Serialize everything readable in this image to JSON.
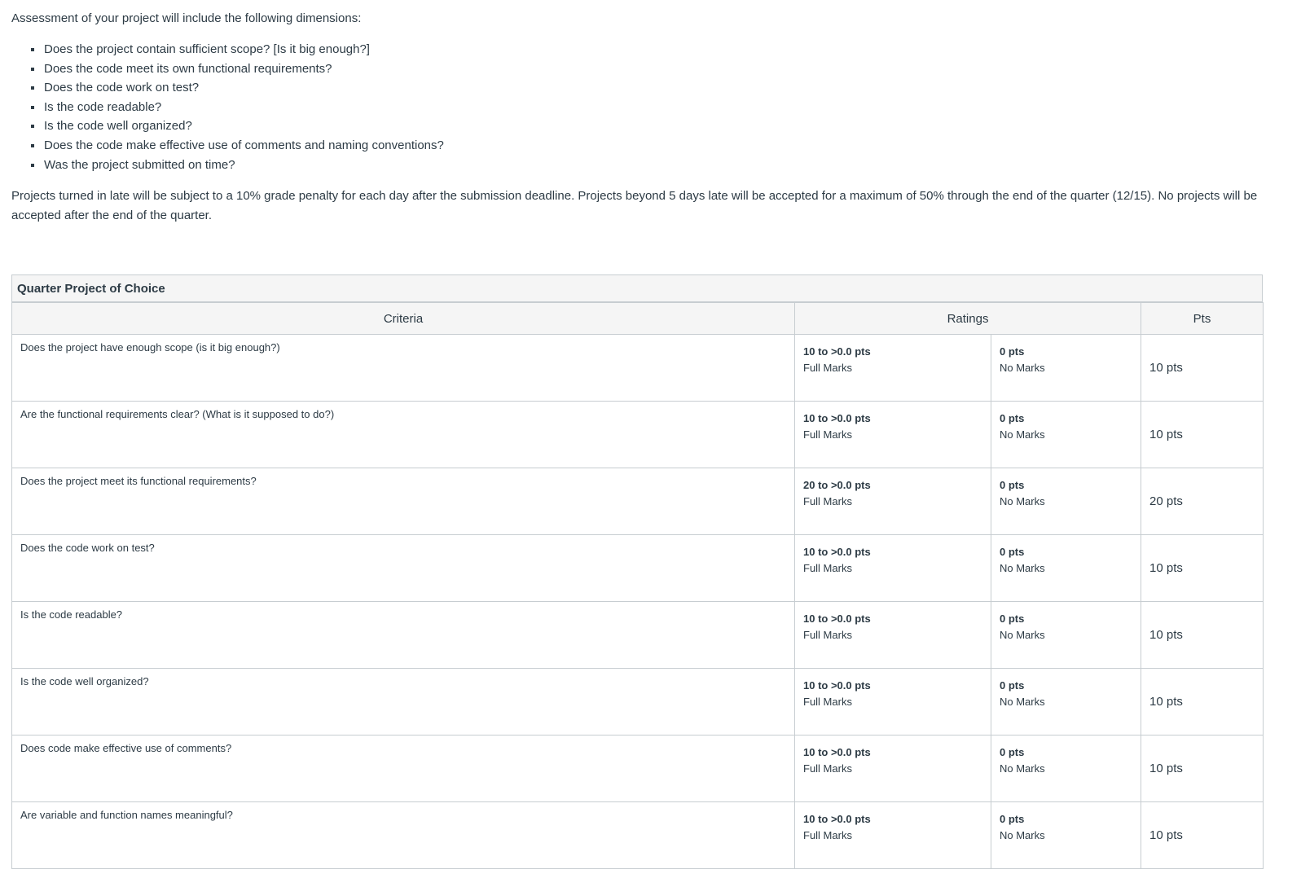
{
  "intro": "Assessment of your project will include the following dimensions:",
  "bullets": [
    "Does the project contain sufficient scope? [Is it big enough?]",
    "Does the code meet its own functional requirements?",
    "Does the code work on test?",
    "Is the code readable?",
    "Is the code well organized?",
    "Does the code make effective use of comments and naming conventions?",
    "Was the project submitted on time?"
  ],
  "late_policy": "Projects turned in late will be subject to a 10% grade penalty for each day after the submission deadline. Projects beyond 5 days late will be accepted for a maximum of 50% through the end of the quarter (12/15). No projects will be accepted after the end of the quarter.",
  "rubric": {
    "title": "Quarter Project of Choice",
    "headers": {
      "criteria": "Criteria",
      "ratings": "Ratings",
      "pts": "Pts"
    },
    "rows": [
      {
        "criterion": "Does the project have enough scope (is it big enough?)",
        "full_pts": "10 to >0.0 pts",
        "full_label": "Full Marks",
        "none_pts": "0 pts",
        "none_label": "No Marks",
        "pts": "10 pts"
      },
      {
        "criterion": "Are the functional requirements clear? (What is it supposed to do?)",
        "full_pts": "10 to >0.0 pts",
        "full_label": "Full Marks",
        "none_pts": "0 pts",
        "none_label": "No Marks",
        "pts": "10 pts"
      },
      {
        "criterion": "Does the project meet its functional requirements?",
        "full_pts": "20 to >0.0 pts",
        "full_label": "Full Marks",
        "none_pts": "0 pts",
        "none_label": "No Marks",
        "pts": "20 pts"
      },
      {
        "criterion": "Does the code work on test?",
        "full_pts": "10 to >0.0 pts",
        "full_label": "Full Marks",
        "none_pts": "0 pts",
        "none_label": "No Marks",
        "pts": "10 pts"
      },
      {
        "criterion": "Is the code readable?",
        "full_pts": "10 to >0.0 pts",
        "full_label": "Full Marks",
        "none_pts": "0 pts",
        "none_label": "No Marks",
        "pts": "10 pts"
      },
      {
        "criterion": "Is the code well organized?",
        "full_pts": "10 to >0.0 pts",
        "full_label": "Full Marks",
        "none_pts": "0 pts",
        "none_label": "No Marks",
        "pts": "10 pts"
      },
      {
        "criterion": "Does code make effective use of comments?",
        "full_pts": "10 to >0.0 pts",
        "full_label": "Full Marks",
        "none_pts": "0 pts",
        "none_label": "No Marks",
        "pts": "10 pts"
      },
      {
        "criterion": "Are variable and function names meaningful?",
        "full_pts": "10 to >0.0 pts",
        "full_label": "Full Marks",
        "none_pts": "0 pts",
        "none_label": "No Marks",
        "pts": "10 pts"
      }
    ]
  }
}
